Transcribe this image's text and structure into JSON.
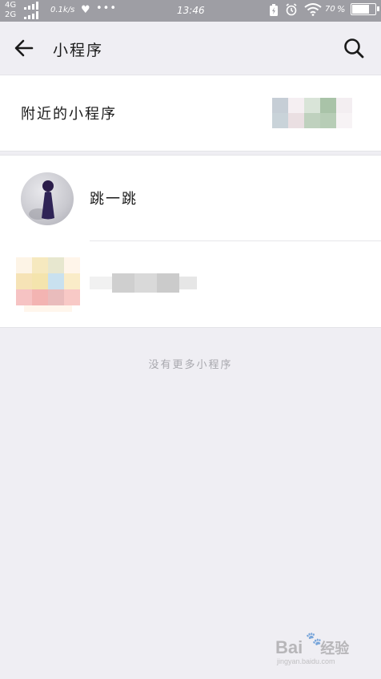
{
  "status_bar": {
    "network_1": "4G",
    "network_2": "2G",
    "speed": "0.1k/s",
    "vpn_glyph": "♥",
    "dots": "•••",
    "time": "13:46",
    "battery_percent": "70",
    "battery_level": 0.7
  },
  "header": {
    "title": "小程序",
    "back_icon": "arrow-left-icon",
    "search_icon": "search-icon"
  },
  "nearby": {
    "label": "附近的小程序"
  },
  "list": {
    "items": [
      {
        "label": "跳一跳"
      }
    ]
  },
  "footer": {
    "no_more": "没有更多小程序"
  },
  "watermark": {
    "brand": "Bai",
    "brand_tail": "经验",
    "sub": "jingyan.baidu.com"
  },
  "colors": {
    "status_bar_bg": "#9e9ea4",
    "page_bg": "#efeef3",
    "card_bg": "#ffffff",
    "muted_text": "#a8a8ae"
  }
}
